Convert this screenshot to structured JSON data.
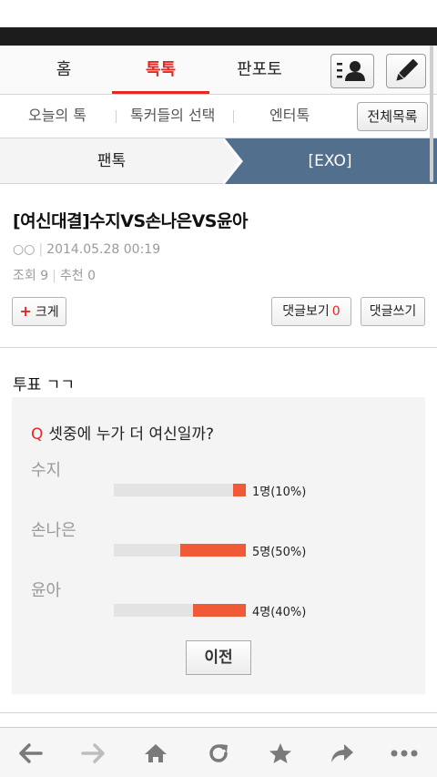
{
  "nav": {
    "tabs": [
      {
        "label": "홈",
        "active": false
      },
      {
        "label": "톡톡",
        "active": true
      },
      {
        "label": "판포토",
        "active": false
      }
    ],
    "profile_icon": "profile-list-icon",
    "write_icon": "pencil-icon"
  },
  "subnav": {
    "items": [
      "오늘의 톡",
      "톡커들의 선택",
      "엔터톡"
    ],
    "all_button": "전체목록"
  },
  "breadcrumb": {
    "left": "팬톡",
    "right": "[EXO]"
  },
  "post": {
    "title": "[여신대결]수지VS손나은VS윤아",
    "author": "○○",
    "date": "2014.05.28 00:19",
    "views_label": "조회",
    "views": "9",
    "recommend_label": "추천",
    "recommends": "0",
    "bigger_button": "크게",
    "comments_button": "댓글보기",
    "comments_count": "0",
    "write_comment_button": "댓글쓰기"
  },
  "poll": {
    "heading": "투표 ㄱㄱ",
    "q_mark": "Q",
    "question": "셋중에 누가 더 여신일까?",
    "options": [
      {
        "name": "수지",
        "result": "1명(10%)",
        "percent": 10
      },
      {
        "name": "손나은",
        "result": "5명(50%)",
        "percent": 50
      },
      {
        "name": "윤아",
        "result": "4명(40%)",
        "percent": 40
      }
    ],
    "prev_button": "이전"
  },
  "colors": {
    "accent": "#e52823",
    "bar_fill": "#f15a37",
    "crumb_active": "#536f8e"
  },
  "browser_bar": {
    "icons": [
      "back-arrow-icon",
      "forward-arrow-icon",
      "home-icon",
      "refresh-icon",
      "star-icon",
      "share-icon",
      "more-icon"
    ]
  }
}
